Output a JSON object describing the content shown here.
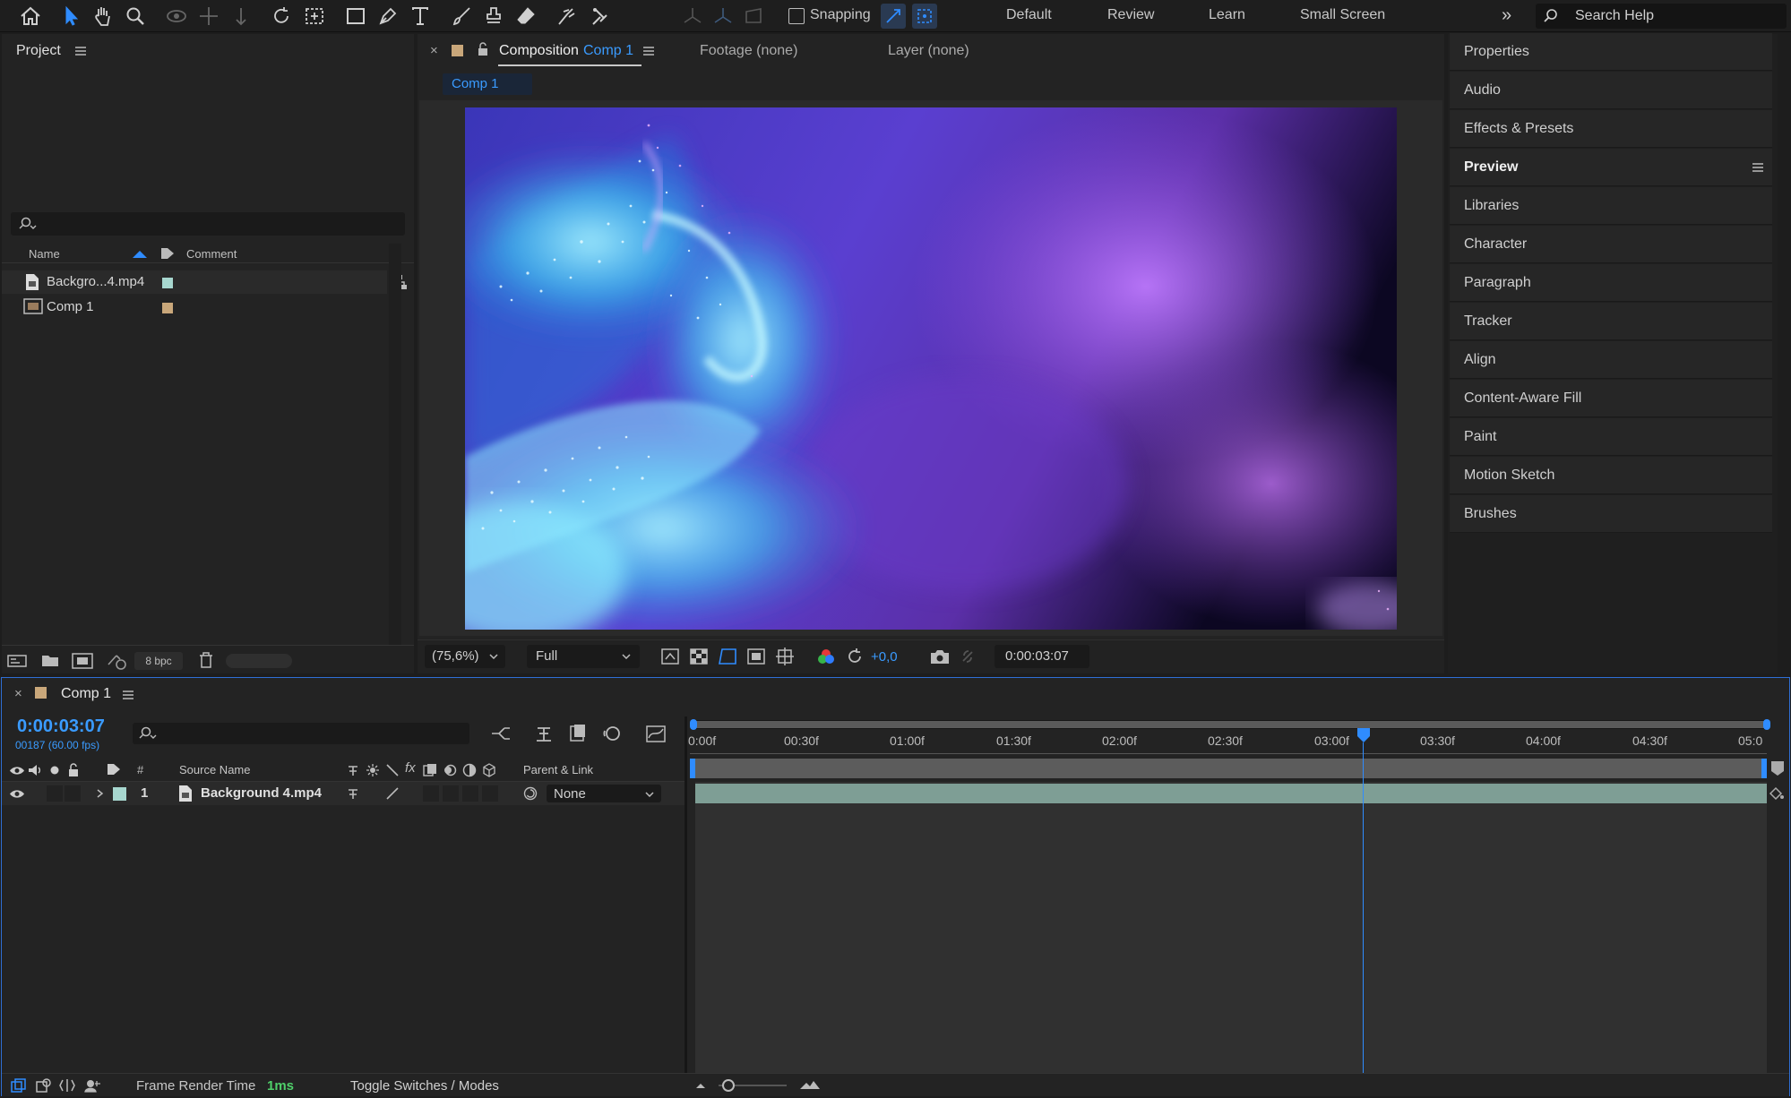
{
  "toolbar": {
    "snapping_label": "Snapping",
    "workspaces": [
      "Default",
      "Review",
      "Learn",
      "Small Screen"
    ],
    "search_placeholder": "Search Help"
  },
  "project": {
    "title": "Project",
    "columns": {
      "name": "Name",
      "comment": "Comment"
    },
    "items": [
      {
        "name": "Backgro...4.mp4",
        "label_color": "#a7d7cf"
      },
      {
        "name": "Comp 1",
        "label_color": "#c9a77a"
      }
    ],
    "bpc": "8 bpc"
  },
  "viewer": {
    "tab_prefix": "Composition",
    "tab_comp": "Comp 1",
    "footage_tab": "Footage (none)",
    "layer_tab": "Layer (none)",
    "sub_tab": "Comp 1",
    "zoom": "(75,6%)",
    "resolution": "Full",
    "exposure": "+0,0",
    "timecode": "0:00:03:07"
  },
  "right_panel": {
    "items": [
      "Properties",
      "Audio",
      "Effects & Presets",
      "Preview",
      "Libraries",
      "Character",
      "Paragraph",
      "Tracker",
      "Align",
      "Content-Aware Fill",
      "Paint",
      "Motion Sketch",
      "Brushes"
    ]
  },
  "timeline": {
    "tab_title": "Comp 1",
    "timecode": "0:00:03:07",
    "frames": "00187 (60.00 fps)",
    "col_source": "Source Name",
    "col_parent": "Parent & Link",
    "col_num": "#",
    "layer": {
      "num": "1",
      "name": "Background 4.mp4",
      "parent": "None"
    },
    "ticks": [
      "0:00f",
      "00:30f",
      "01:00f",
      "01:30f",
      "02:00f",
      "02:30f",
      "03:00f",
      "03:30f",
      "04:00f",
      "04:30f",
      "05:0"
    ],
    "playhead_seconds": 3.12,
    "duration_seconds": 5
  },
  "status": {
    "frame_render_label": "Frame Render Time",
    "frame_render_value": "1ms",
    "toggle_label": "Toggle Switches / Modes"
  },
  "colors": {
    "accent": "#2f8cff",
    "timecode": "#3a9bff",
    "layer_bar": "#7e9e95"
  }
}
